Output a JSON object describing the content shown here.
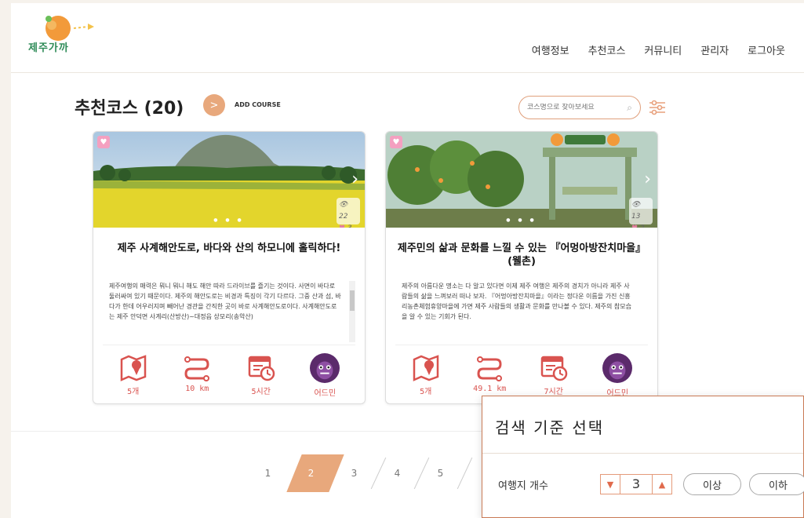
{
  "header": {
    "logo_text": "제주가까",
    "nav": [
      "여행정보",
      "추천코스",
      "커뮤니티",
      "관리자",
      "로그아웃"
    ]
  },
  "page": {
    "title": "추천코스 (20)",
    "add_button_glyph": ">",
    "add_label": "ADD COURSE",
    "search_placeholder": "코스명으로 찾아보세요"
  },
  "cards": [
    {
      "views": "22",
      "likes": "3",
      "title": "제주 사계해안도로, 바다와 산의 하모니에 홀릭하다!",
      "description": "제주여행의 매력은 뭐니 뭐니 해도 해안 따라 드라이브를 즐기는 것이다. 사면이 바다로 둘러싸여 있기 때문이다. 제주의 해안도로는 비경과 특징이 각기 다르다. 그중 산과 섬, 바다가 한데 어우러지며 빼어난 경관을 간직한 곳이 바로 사계해안도로이다. 사계해안도로는 제주 안덕면 사계리(산방산)~대정읍 상모리(송악산)",
      "places": "5개",
      "distance": "10 km",
      "time": "5시간",
      "author": "어드민"
    },
    {
      "views": "13",
      "likes": "2",
      "title": "제주민의 삶과 문화를 느낄 수 있는 『어멍아방잔치마을』 (웰촌)",
      "description": "제주의 아름다운 명소는 다 알고 있다면 이제 제주 여행은 제주의 경치가 아니라 제주 사람들의 삶을 느껴보러 떠나 보자. 『어멍아방잔치마을』이라는 정다운 이름을 가진 신흥리농촌체험휴양마을에 가면 제주 사람들의 생활과 문화를 만나볼 수 있다. 제주의 참모습을 알 수 있는 기회가 된다.",
      "places": "5개",
      "distance": "49.1 km",
      "time": "7시간",
      "author": "어드민"
    }
  ],
  "pagination": {
    "pages": [
      "1",
      "2",
      "3",
      "4",
      "5"
    ],
    "active": "2"
  },
  "modal": {
    "title": "검색 기준 선택",
    "row_label": "여행지 개수",
    "stepper_value": "3",
    "option_above": "이상",
    "option_below": "이하"
  }
}
